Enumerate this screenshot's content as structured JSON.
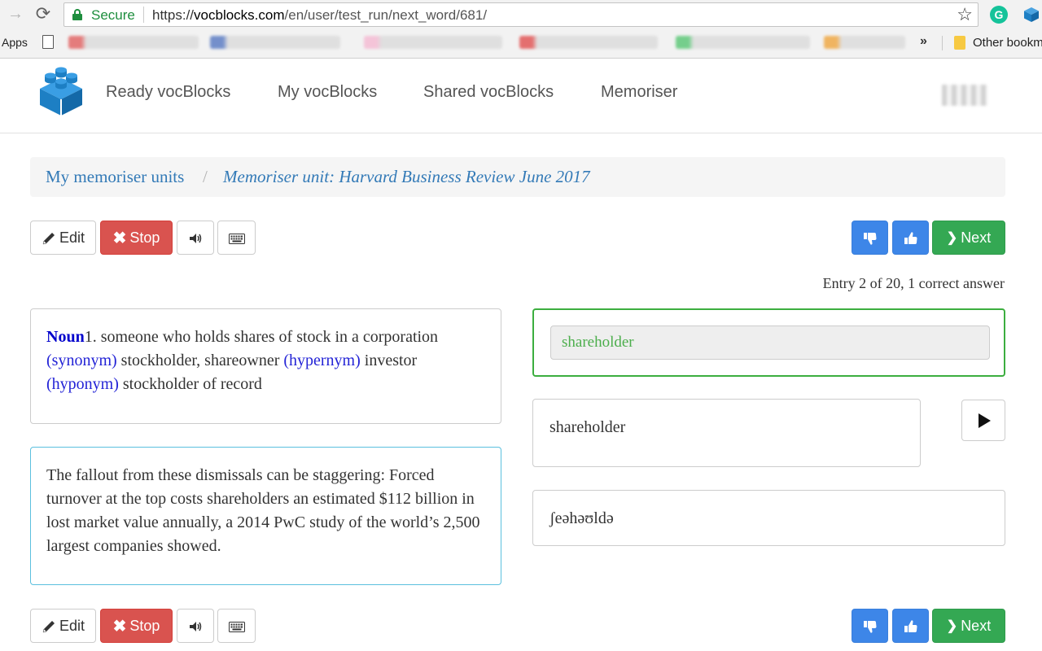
{
  "browser": {
    "secure_label": "Secure",
    "url_scheme": "https://",
    "url_host": "vocblocks.com",
    "url_path": "/en/user/test_run/next_word/681/",
    "bookmarks": {
      "apps_label": "Apps",
      "more_label": "»",
      "other_label": "Other bookm"
    }
  },
  "nav": {
    "items": [
      {
        "label": "Ready vocBlocks"
      },
      {
        "label": "My vocBlocks"
      },
      {
        "label": "Shared vocBlocks"
      },
      {
        "label": "Memoriser"
      }
    ],
    "brand_color": "#1d8fd8"
  },
  "breadcrumb": {
    "items": [
      {
        "label": "My memoriser units"
      },
      {
        "label": "Memoriser unit: Harvard Business Review June 2017"
      }
    ],
    "separator": "/"
  },
  "toolbar": {
    "edit_label": "Edit",
    "stop_label": "Stop",
    "next_label": "Next"
  },
  "status": {
    "text": "Entry 2 of 20, 1 correct answer"
  },
  "definition": {
    "pos": "Noun",
    "sense_number": "1.",
    "gloss": "someone who holds shares of stock in a corporation",
    "synonym_tag": "(synonym)",
    "synonyms": "stockholder, shareowner",
    "hypernym_tag": "(hypernym)",
    "hypernym": "investor",
    "hyponym_tag": "(hyponym)",
    "hyponym": "stockholder of record"
  },
  "example": {
    "text": "The fallout from these dismissals can be staggering: Forced turnover at the top costs shareholders an estimated $112 billion in lost market value annually, a 2014 PwC study of the world’s 2,500 largest companies showed."
  },
  "answer": {
    "value": "shareholder",
    "status_color": "#3cae3f"
  },
  "word": {
    "text": "shareholder",
    "ipa": "ʃeəhəʊldə"
  }
}
